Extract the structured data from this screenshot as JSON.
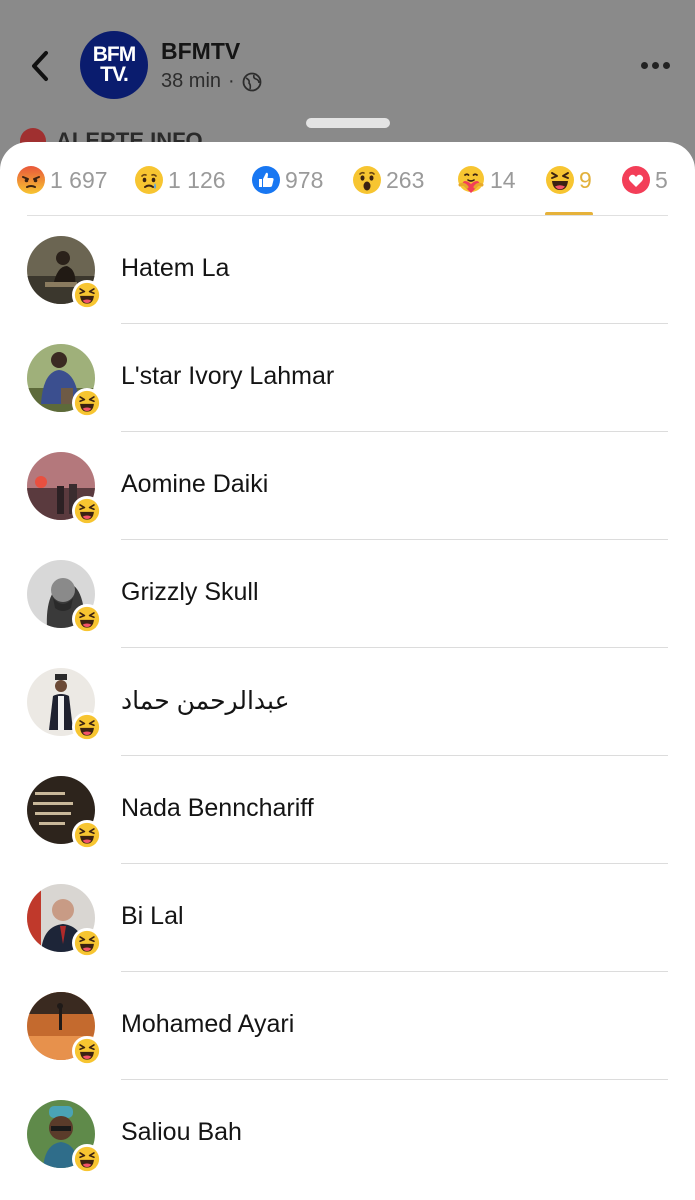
{
  "post": {
    "page_name": "BFMTV",
    "logo_line1": "BFM",
    "logo_line2": "TV.",
    "time": "38 min",
    "separator": "·",
    "peek_text": "ALERTE INFO"
  },
  "reaction_tabs": [
    {
      "icon": "angry-icon",
      "count": "1 697",
      "active": false
    },
    {
      "icon": "sad-icon",
      "count": "1 126",
      "active": false
    },
    {
      "icon": "like-icon",
      "count": "978",
      "active": false
    },
    {
      "icon": "wow-icon",
      "count": "263",
      "active": false
    },
    {
      "icon": "care-icon",
      "count": "14",
      "active": false
    },
    {
      "icon": "haha-icon",
      "count": "9",
      "active": true
    },
    {
      "icon": "love-icon",
      "count": "5",
      "active": false
    }
  ],
  "people": [
    {
      "name": "Hatem La",
      "reaction": "haha-icon"
    },
    {
      "name": "L'star Ivory Lahmar",
      "reaction": "haha-icon"
    },
    {
      "name": "Aomine Daiki",
      "reaction": "haha-icon"
    },
    {
      "name": "Grizzly Skull",
      "reaction": "haha-icon"
    },
    {
      "name": "عبدالرحمن حماد",
      "reaction": "haha-icon"
    },
    {
      "name": "Nada Bennchariff",
      "reaction": "haha-icon"
    },
    {
      "name": "Bi Lal",
      "reaction": "haha-icon"
    },
    {
      "name": "Mohamed Ayari",
      "reaction": "haha-icon"
    },
    {
      "name": "Saliou Bah",
      "reaction": "haha-icon"
    }
  ],
  "colors": {
    "active_tab": "#e2b13b",
    "inactive_tab": "#9a9a9a",
    "like_blue": "#1877f2",
    "love_red": "#f33e58",
    "emoji_yellow": "#f7c531"
  }
}
